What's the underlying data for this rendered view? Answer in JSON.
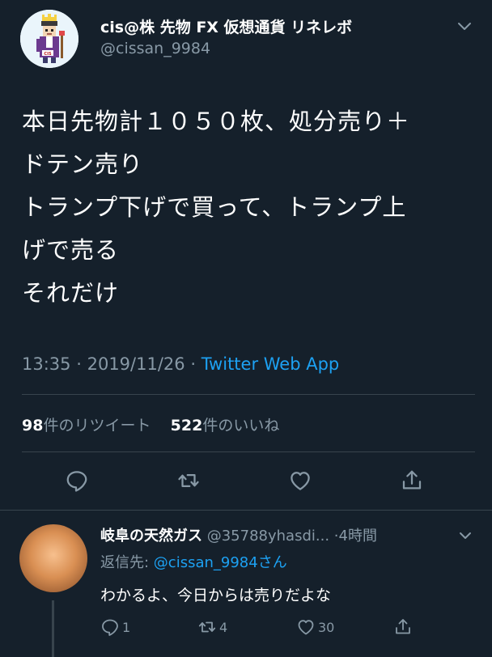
{
  "tweet": {
    "display_name": "cis@株 先物 FX 仮想通貨 リネレボ",
    "handle": "@cissan_9984",
    "text_lines": [
      "本日先物計１０５０枚、処分売り＋",
      "ドテン売り",
      "トランプ下げで買って、トランプ上",
      "げで売る",
      "それだけ"
    ],
    "time": "13:35",
    "date": "2019/11/26",
    "separator": "·",
    "source": "Twitter Web App",
    "retweet_count": "98",
    "retweet_label": "件のリツイート",
    "like_count": "522",
    "like_label": "件のいいね"
  },
  "actions": {
    "reply_icon": "reply-icon",
    "retweet_icon": "retweet-icon",
    "like_icon": "heart-icon",
    "share_icon": "share-icon"
  },
  "reply": {
    "display_name": "岐阜の天然ガス",
    "handle": "@35788yhasdi...",
    "time": "4時間",
    "separator": "·",
    "replying_prefix": "返信先: ",
    "replying_mention": "@cissan_9984",
    "replying_suffix": "さん",
    "text": "わかるよ、今日からは売りだよな",
    "reply_count": "1",
    "retweet_count": "4",
    "like_count": "30"
  },
  "colors": {
    "background": "#15202b",
    "secondary_text": "#8899a6",
    "accent": "#1da1f2",
    "divider": "#38444d"
  }
}
